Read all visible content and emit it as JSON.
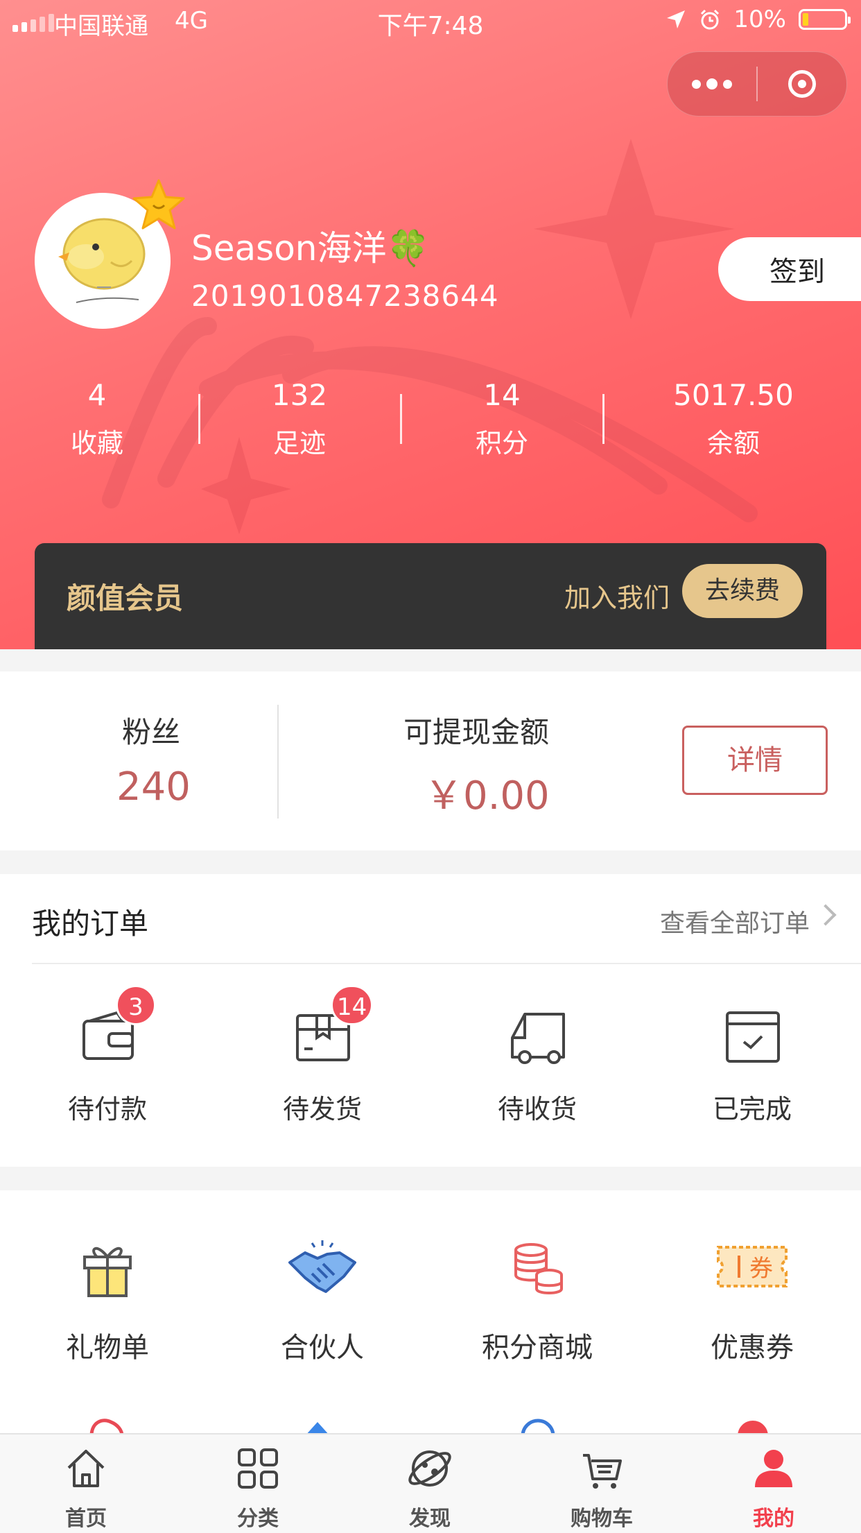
{
  "status_bar": {
    "carrier": "中国联通",
    "network": "4G",
    "time": "下午7:48",
    "battery": "10%"
  },
  "profile": {
    "username": "Season海洋🍀",
    "user_id": "2019010847238644",
    "checkin_label": "签到"
  },
  "stats": [
    {
      "value": "4",
      "label": "收藏"
    },
    {
      "value": "132",
      "label": "足迹"
    },
    {
      "value": "14",
      "label": "积分"
    },
    {
      "value": "5017.50",
      "label": "余额"
    }
  ],
  "vip": {
    "title": "颜值会员",
    "join_label": "加入我们",
    "renew_label": "去续费"
  },
  "earnings": {
    "fans_label": "粉丝",
    "fans_value": "240",
    "withdraw_label": "可提现金额",
    "withdraw_value": "￥0.00",
    "detail_label": "详情"
  },
  "orders": {
    "title": "我的订单",
    "view_all": "查看全部订单",
    "items": [
      {
        "label": "待付款",
        "icon": "wallet-icon",
        "badge": "3"
      },
      {
        "label": "待发货",
        "icon": "package-icon",
        "badge": "14"
      },
      {
        "label": "待收货",
        "icon": "truck-icon",
        "badge": ""
      },
      {
        "label": "已完成",
        "icon": "completed-box-icon",
        "badge": ""
      }
    ]
  },
  "services": [
    {
      "label": "礼物单",
      "icon": "gift-icon"
    },
    {
      "label": "合伙人",
      "icon": "handshake-icon"
    },
    {
      "label": "积分商城",
      "icon": "coins-icon"
    },
    {
      "label": "优惠券",
      "icon": "coupon-icon",
      "icon_text": "券"
    }
  ],
  "tabbar": [
    {
      "label": "首页",
      "icon": "home-icon",
      "active": false
    },
    {
      "label": "分类",
      "icon": "grid-icon",
      "active": false
    },
    {
      "label": "发现",
      "icon": "planet-icon",
      "active": false
    },
    {
      "label": "购物车",
      "icon": "cart-icon",
      "active": false
    },
    {
      "label": "我的",
      "icon": "user-icon",
      "active": true
    }
  ],
  "colors": {
    "accent": "#f2404d",
    "gold": "#e6c68c",
    "price": "#c0605f"
  }
}
